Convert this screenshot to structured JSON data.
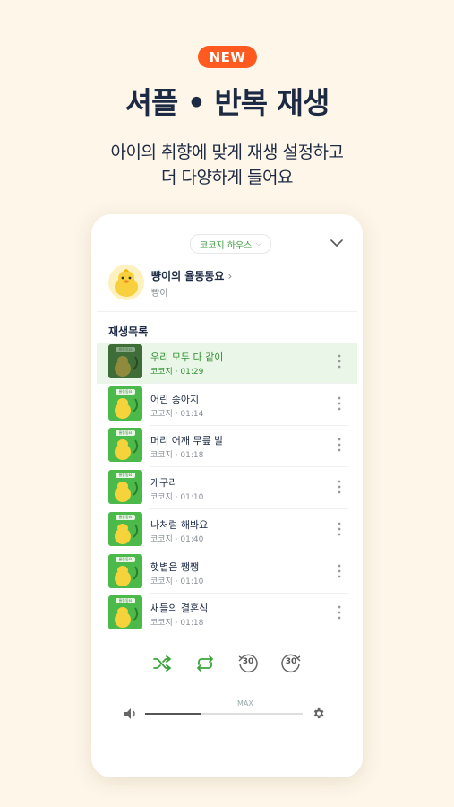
{
  "promo": {
    "badge": "NEW",
    "headline": "셔플 • 반복 재생",
    "sub_line1": "아이의 취향에 맞게 재생 설정하고",
    "sub_line2": "더 다양하게 들어요"
  },
  "player": {
    "channel": "코코지 하우스",
    "album_title": "뺭이의 율동동요",
    "album_artist": "뺭이",
    "playlist_label": "재생목록",
    "tracks": [
      {
        "title": "우리 모두 다 같이",
        "meta": "코코지 · 01:29",
        "active": true
      },
      {
        "title": "어린 송아지",
        "meta": "코코지 · 01:14",
        "active": false
      },
      {
        "title": "머리 어깨 무릎 발",
        "meta": "코코지 · 01:18",
        "active": false
      },
      {
        "title": "개구리",
        "meta": "코코지 · 01:10",
        "active": false
      },
      {
        "title": "나처럼 해봐요",
        "meta": "코코지 · 01:40",
        "active": false
      },
      {
        "title": "햇볕은 쨍쨍",
        "meta": "코코지 · 01:10",
        "active": false
      },
      {
        "title": "새들의 결혼식",
        "meta": "코코지 · 01:18",
        "active": false
      }
    ],
    "thumb_label": "율동동요",
    "rewind_label": "30",
    "forward_label": "30",
    "volume_max_label": "MAX",
    "volume_level": 0.35,
    "colors": {
      "accent": "#3aa63a",
      "badge": "#ff5a1f",
      "active_row": "#eaf6e8"
    }
  }
}
